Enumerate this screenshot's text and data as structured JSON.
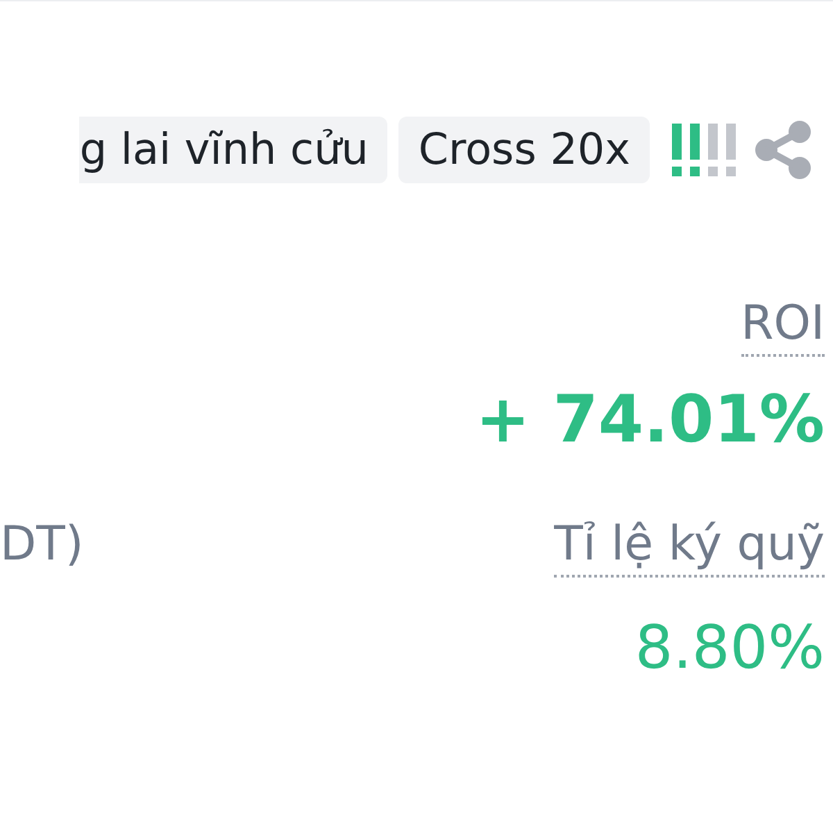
{
  "tags": [
    "g lai vĩnh cửu",
    "Cross 20x"
  ],
  "risk_meter": {
    "level": 0.5
  },
  "roi": {
    "label": "ROI",
    "value": "+ 74.01%"
  },
  "size_label": "DT)",
  "margin_ratio": {
    "label": "Tỉ lệ ký quỹ",
    "value": "8.80%"
  }
}
